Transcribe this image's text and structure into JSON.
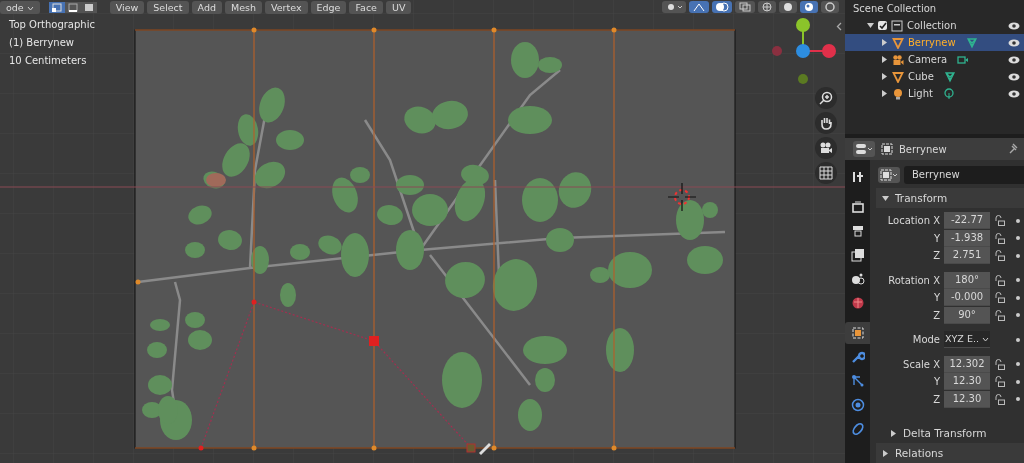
{
  "header": {
    "mode": "ode",
    "select_modes": [
      {
        "kind": "vertex",
        "selected": true
      },
      {
        "kind": "edge",
        "selected": false
      },
      {
        "kind": "face",
        "selected": false
      }
    ],
    "menus": [
      "View",
      "Select",
      "Add",
      "Mesh",
      "Vertex",
      "Edge",
      "Face",
      "UV"
    ],
    "toggles": [
      {
        "kind": "snap",
        "on": true
      },
      {
        "kind": "overlay",
        "on": true
      },
      {
        "kind": "xray",
        "on": false
      }
    ],
    "shading": [
      {
        "kind": "wireframe",
        "selected": false
      },
      {
        "kind": "solid",
        "selected": false
      },
      {
        "kind": "material",
        "selected": true
      },
      {
        "kind": "rendered",
        "selected": false
      }
    ]
  },
  "viewport": {
    "overlay_lines": [
      "Top Orthographic",
      "(1) Berrynew",
      "10 Centimeters"
    ]
  },
  "outliner": {
    "root": {
      "label": "Scene Collection",
      "children": [
        {
          "label": "Collection",
          "kind": "collection",
          "checked": true,
          "expanded": true,
          "selected": false,
          "children": [
            {
              "label": "Berrynew",
              "kind": "mesh",
              "expanded": false,
              "selected": true
            },
            {
              "label": "Camera",
              "kind": "camera",
              "expanded": false,
              "selected": false
            },
            {
              "label": "Cube",
              "kind": "mesh",
              "expanded": false,
              "selected": false
            },
            {
              "label": "Light",
              "kind": "light",
              "expanded": false,
              "selected": false
            }
          ]
        }
      ]
    }
  },
  "properties": {
    "header_name": "Berrynew",
    "object_name": "Berrynew",
    "tabs": [
      {
        "kind": "tool",
        "selected": false
      },
      {
        "kind": "render",
        "selected": false
      },
      {
        "kind": "output",
        "selected": false
      },
      {
        "kind": "view_layer",
        "selected": false
      },
      {
        "kind": "scene",
        "selected": false
      },
      {
        "kind": "world",
        "selected": false
      },
      {
        "kind": "object",
        "selected": true
      },
      {
        "kind": "modifiers",
        "selected": false
      },
      {
        "kind": "particles",
        "selected": false
      },
      {
        "kind": "physics",
        "selected": false
      },
      {
        "kind": "constraints",
        "selected": false
      }
    ],
    "panels": [
      {
        "title": "Transform",
        "expanded": true,
        "groups": [
          {
            "rows": [
              {
                "label": "Location X",
                "value": "-22.77",
                "kind": "number"
              },
              {
                "label": "Y",
                "value": "-1.938",
                "kind": "number"
              },
              {
                "label": "Z",
                "value": "2.751",
                "kind": "number"
              }
            ]
          },
          {
            "rows": [
              {
                "label": "Rotation X",
                "value": "180°",
                "kind": "number"
              },
              {
                "label": "Y",
                "value": "-0.000",
                "kind": "number"
              },
              {
                "label": "Z",
                "value": "90°",
                "kind": "number"
              }
            ]
          },
          {
            "rows": [
              {
                "label": "Mode",
                "value": "XYZ E..",
                "kind": "dropdown"
              }
            ]
          },
          {
            "rows": [
              {
                "label": "Scale X",
                "value": "12.302",
                "kind": "number"
              },
              {
                "label": "Y",
                "value": "12.30",
                "kind": "number"
              },
              {
                "label": "Z",
                "value": "12.30",
                "kind": "number"
              }
            ]
          }
        ]
      },
      {
        "title": "Delta Transform",
        "expanded": false,
        "sub": true
      },
      {
        "title": "Relations",
        "expanded": false,
        "sub": false
      }
    ]
  }
}
